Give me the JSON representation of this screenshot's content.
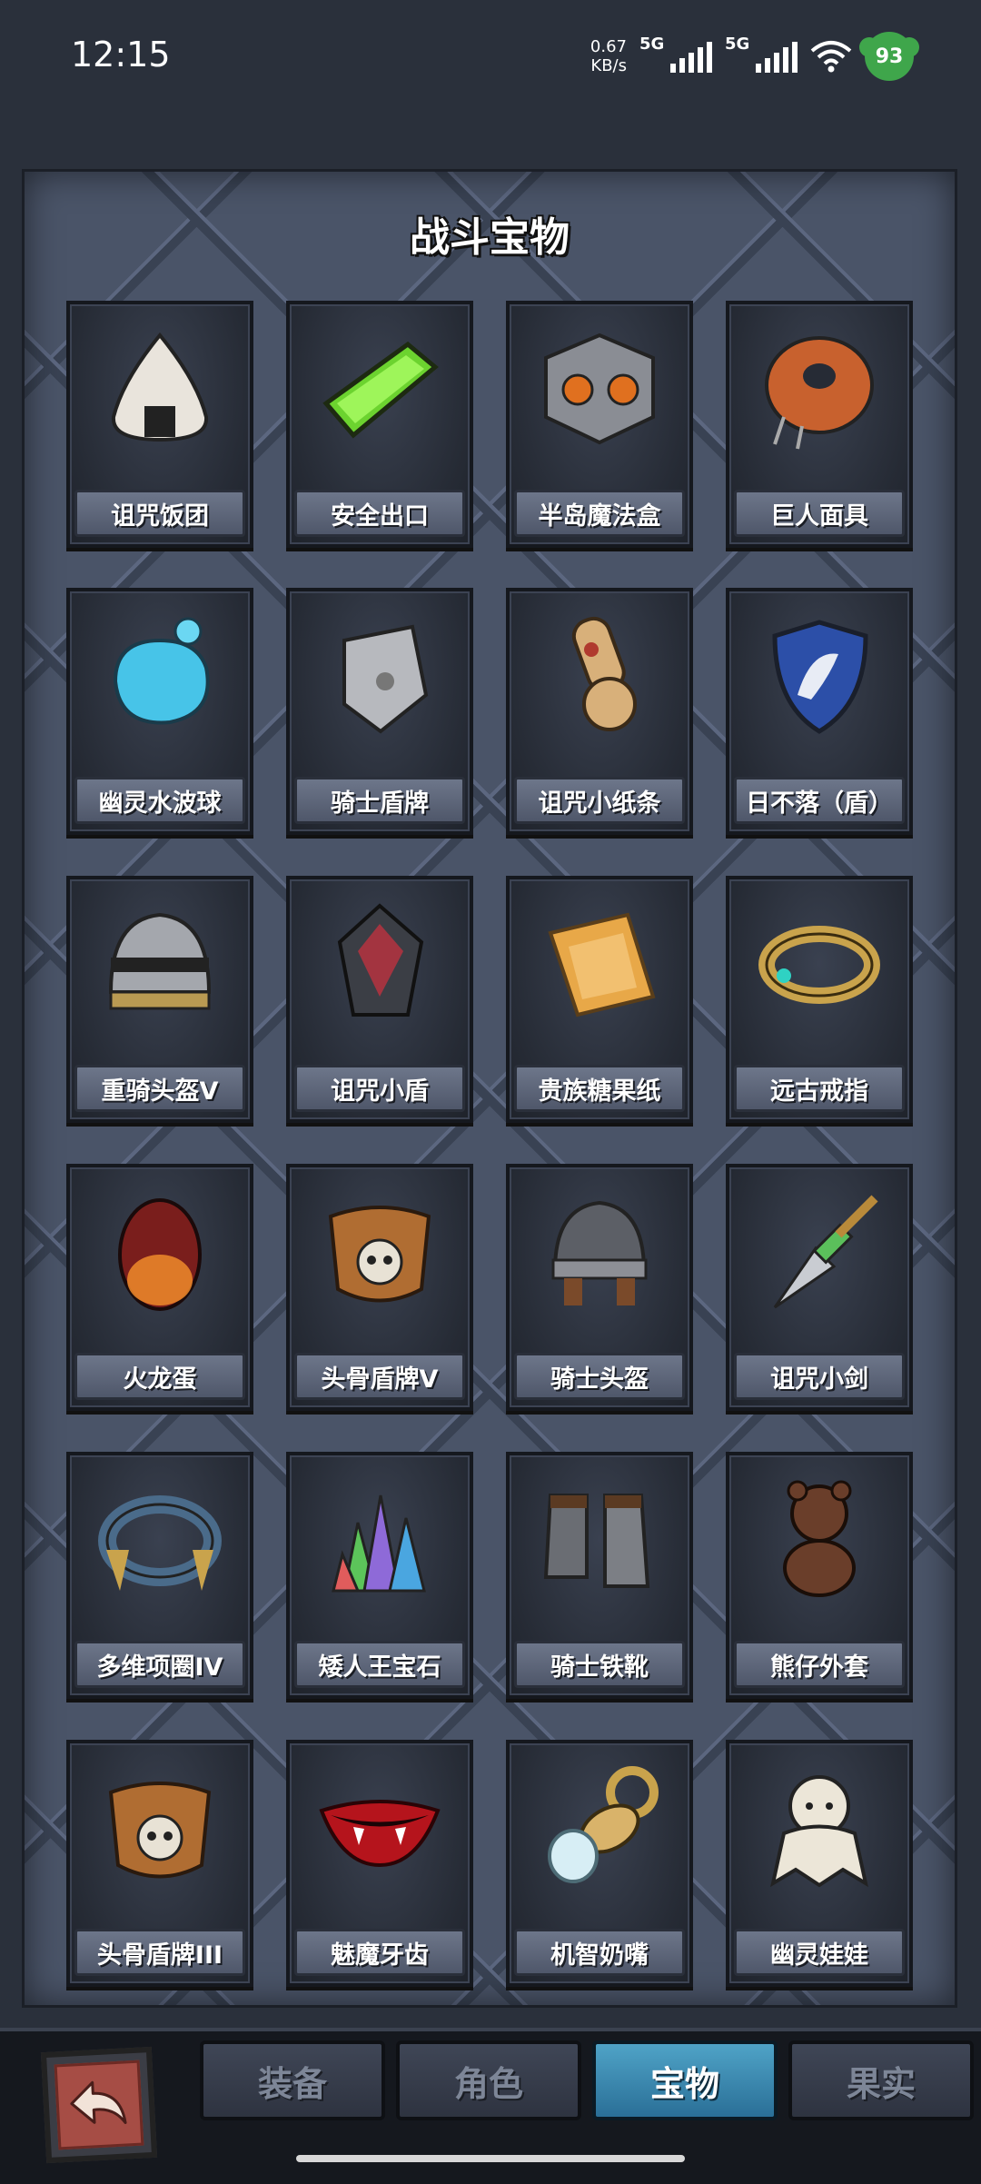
{
  "status_bar": {
    "time": "12:15",
    "net_speed_value": "0.67",
    "net_speed_unit": "KB/s",
    "signal1_label": "5G",
    "signal2_label": "5G",
    "battery_level": "93"
  },
  "panel": {
    "title": "战斗宝物"
  },
  "items": [
    {
      "label": "诅咒饭团",
      "icon": "rice-ball-icon"
    },
    {
      "label": "安全出口",
      "icon": "exit-sign-icon"
    },
    {
      "label": "半岛魔法盒",
      "icon": "magic-box-icon"
    },
    {
      "label": "巨人面具",
      "icon": "giant-mask-icon"
    },
    {
      "label": "幽灵水波球",
      "icon": "water-orb-icon"
    },
    {
      "label": "骑士盾牌",
      "icon": "knight-shield-icon"
    },
    {
      "label": "诅咒小纸条",
      "icon": "scroll-icon"
    },
    {
      "label": "日不落（盾）",
      "icon": "unicorn-shield-icon"
    },
    {
      "label": "重骑头盔V",
      "icon": "heavy-helmet-icon"
    },
    {
      "label": "诅咒小盾",
      "icon": "cursed-shield-icon"
    },
    {
      "label": "贵族糖果纸",
      "icon": "candy-wrapper-icon"
    },
    {
      "label": "远古戒指",
      "icon": "ancient-ring-icon"
    },
    {
      "label": "火龙蛋",
      "icon": "dragon-egg-icon"
    },
    {
      "label": "头骨盾牌V",
      "icon": "skull-shield-icon"
    },
    {
      "label": "骑士头盔",
      "icon": "knight-helmet-icon"
    },
    {
      "label": "诅咒小剑",
      "icon": "cursed-dagger-icon"
    },
    {
      "label": "多维项圈IV",
      "icon": "collar-icon"
    },
    {
      "label": "矮人王宝石",
      "icon": "gem-cluster-icon"
    },
    {
      "label": "骑士铁靴",
      "icon": "iron-boots-icon"
    },
    {
      "label": "熊仔外套",
      "icon": "teddy-bear-icon"
    },
    {
      "label": "头骨盾牌III",
      "icon": "skull-shield-icon"
    },
    {
      "label": "魅魔牙齿",
      "icon": "vampire-lips-icon"
    },
    {
      "label": "机智奶嘴",
      "icon": "pacifier-icon"
    },
    {
      "label": "幽灵娃娃",
      "icon": "ghost-doll-icon"
    }
  ],
  "tabs": [
    {
      "label": "装备",
      "active": false
    },
    {
      "label": "角色",
      "active": false
    },
    {
      "label": "宝物",
      "active": true
    },
    {
      "label": "果实",
      "active": false
    }
  ],
  "colors": {
    "active_tab": "#3f8db5",
    "panel_bg": "#4a5468",
    "back_button": "#a64d45"
  }
}
